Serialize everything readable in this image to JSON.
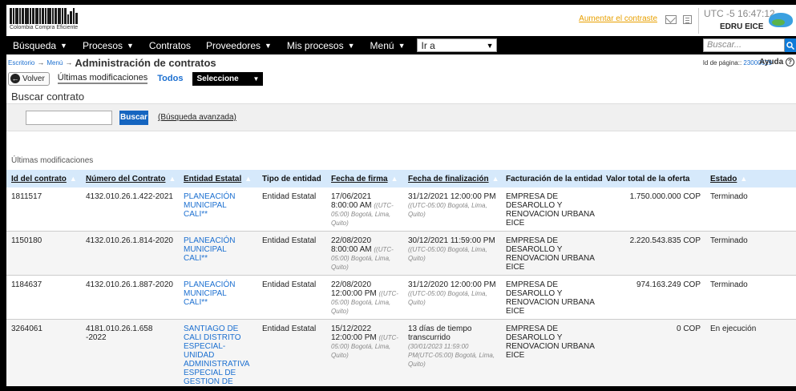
{
  "header": {
    "logo_caption": "Colombia Compra Eficiente",
    "contrast_link": "Aumentar el contraste",
    "clock": "UTC -5 16:47:12",
    "user": "EDRU EICE"
  },
  "nav": {
    "items": [
      {
        "label": "Búsqueda",
        "caret": true
      },
      {
        "label": "Procesos",
        "caret": true
      },
      {
        "label": "Contratos",
        "caret": false
      },
      {
        "label": "Proveedores",
        "caret": true
      },
      {
        "label": "Mis procesos",
        "caret": true
      },
      {
        "label": "Menú",
        "caret": true
      }
    ],
    "goto_label": "Ir a",
    "search_placeholder": "Buscar..."
  },
  "breadcrumb": {
    "items": [
      "Escritorio",
      "Menú"
    ],
    "title": "Administración de contratos",
    "page_id_label": "Id de página::",
    "page_id": "23000629",
    "help": "Ayuda"
  },
  "toolbar": {
    "back": "Volver",
    "tab_recent": "Últimas modificaciones",
    "tab_all": "Todos",
    "select": "Seleccione"
  },
  "search": {
    "title": "Buscar contrato",
    "button": "Buscar",
    "advanced": "(Búsqueda avanzada)"
  },
  "list_caption": "Últimas modificaciones",
  "table": {
    "columns": [
      {
        "label": "Id del contrato",
        "sortable": true
      },
      {
        "label": "Número del Contrato",
        "sortable": true
      },
      {
        "label": "Entidad Estatal",
        "sortable": true
      },
      {
        "label": "Tipo de entidad",
        "sortable": false
      },
      {
        "label": "Fecha de firma",
        "sortable": true
      },
      {
        "label": "Fecha de finalización",
        "sortable": true
      },
      {
        "label": "Facturación de la entidad",
        "sortable": false
      },
      {
        "label": "Valor total de la oferta",
        "sortable": false
      },
      {
        "label": "Estado",
        "sortable": true
      }
    ],
    "rows": [
      {
        "id": "1811517",
        "numero": "4132.010.26.1.422-2021",
        "entidad": "PLANEACIÓN MUNICIPAL CALI**",
        "tipo": "Entidad Estatal",
        "firma": "17/06/2021 8:00:00 AM",
        "firma_tz": "((UTC-05:00) Bogotá, Lima, Quito)",
        "fin": "31/12/2021 12:00:00 PM",
        "fin_tz": "((UTC-05:00) Bogotá, Lima, Quito)",
        "facturacion": "EMPRESA DE DESAROLLO Y RENOVACION URBANA EICE",
        "valor": "1.750.000.000 COP",
        "estado": "Terminado"
      },
      {
        "id": "1150180",
        "numero": "4132.010.26.1.814-2020",
        "entidad": "PLANEACIÓN MUNICIPAL CALI**",
        "tipo": "Entidad Estatal",
        "firma": "22/08/2020 8:00:00 AM",
        "firma_tz": "((UTC-05:00) Bogotá, Lima, Quito)",
        "fin": "30/12/2021 11:59:00 PM",
        "fin_tz": "((UTC-05:00) Bogotá, Lima, Quito)",
        "facturacion": "EMPRESA DE DESAROLLO Y RENOVACION URBANA EICE",
        "valor": "2.220.543.835 COP",
        "estado": "Terminado"
      },
      {
        "id": "1184637",
        "numero": "4132.010.26.1.887-2020",
        "entidad": "PLANEACIÓN MUNICIPAL CALI**",
        "tipo": "Entidad Estatal",
        "firma": "22/08/2020 12:00:00 PM",
        "firma_tz": "((UTC-05:00) Bogotá, Lima, Quito)",
        "fin": "31/12/2020 12:00:00 PM",
        "fin_tz": "((UTC-05:00) Bogotá, Lima, Quito)",
        "facturacion": "EMPRESA DE DESAROLLO Y RENOVACION URBANA EICE",
        "valor": "974.163.249 COP",
        "estado": "Terminado"
      },
      {
        "id": "3264061",
        "numero": "4181.010.26.1.658 -2022",
        "entidad": "SANTIAGO DE CALI DISTRITO ESPECIAL-UNIDAD ADMINISTRATIVA ESPECIAL DE GESTION DE BIENES Y",
        "tipo": "Entidad Estatal",
        "firma": "15/12/2022 12:00:00 PM",
        "firma_tz": "((UTC-05:00) Bogotá, Lima, Quito)",
        "fin": "13 días de tiempo transcurrido",
        "fin_tz": "(30/01/2023 11:59:00 PM(UTC-05:00) Bogotá, Lima, Quito)",
        "facturacion": "EMPRESA DE DESAROLLO Y RENOVACION URBANA EICE",
        "valor": "0 COP",
        "estado": "En ejecución"
      }
    ]
  }
}
